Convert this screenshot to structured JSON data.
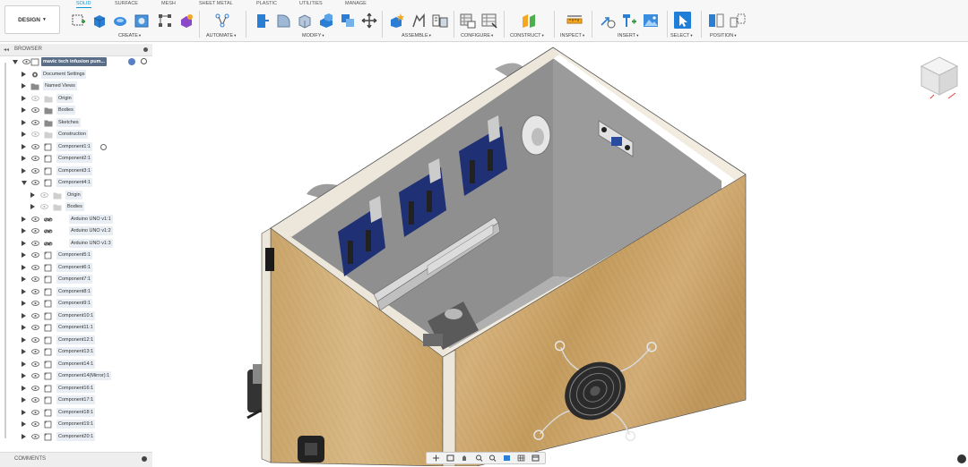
{
  "toolbar": {
    "workspace": "DESIGN",
    "tabs": [
      "SOLID",
      "SURFACE",
      "MESH",
      "SHEET METAL",
      "PLASTIC",
      "UTILITIES",
      "MANAGE"
    ],
    "active_tab": "SOLID",
    "groups": {
      "create": "CREATE",
      "automate": "AUTOMATE",
      "modify": "MODIFY",
      "assemble": "ASSEMBLE",
      "configure": "CONFIGURE",
      "construct": "CONSTRUCT",
      "inspect": "INSPECT",
      "insert": "INSERT",
      "select": "SELECT",
      "position": "POSITION"
    },
    "accent": "#0696d7"
  },
  "browser": {
    "title": "BROWSER",
    "items": [
      {
        "label": "mavic tech infusion pum...",
        "type": "root"
      },
      {
        "label": "Document Settings",
        "type": "settings"
      },
      {
        "label": "Named Views",
        "type": "folder"
      },
      {
        "label": "Origin",
        "type": "folder"
      },
      {
        "label": "Bodies",
        "type": "folder"
      },
      {
        "label": "Sketches",
        "type": "folder"
      },
      {
        "label": "Construction",
        "type": "folder"
      },
      {
        "label": "Component1:1",
        "type": "component"
      },
      {
        "label": "Component2:1",
        "type": "component"
      },
      {
        "label": "Component3:1",
        "type": "component"
      },
      {
        "label": "Component4:1",
        "type": "component"
      },
      {
        "label": "Origin",
        "type": "folder"
      },
      {
        "label": "Bodies",
        "type": "folder"
      },
      {
        "label": "Arduino UNO v1:1",
        "type": "link"
      },
      {
        "label": "Arduino UNO v1:2",
        "type": "link"
      },
      {
        "label": "Arduino UNO v1:3",
        "type": "link"
      },
      {
        "label": "Component5:1",
        "type": "component"
      },
      {
        "label": "Component6:1",
        "type": "component"
      },
      {
        "label": "Component7:1",
        "type": "component"
      },
      {
        "label": "Component8:1",
        "type": "component"
      },
      {
        "label": "Component9:1",
        "type": "component"
      },
      {
        "label": "Component10:1",
        "type": "component"
      },
      {
        "label": "Component11:1",
        "type": "component"
      },
      {
        "label": "Component12:1",
        "type": "component"
      },
      {
        "label": "Component13:1",
        "type": "component"
      },
      {
        "label": "Component14:1",
        "type": "component"
      },
      {
        "label": "Component14(Mirror):1",
        "type": "component"
      },
      {
        "label": "Component16:1",
        "type": "component"
      },
      {
        "label": "Component17:1",
        "type": "component"
      },
      {
        "label": "Component18:1",
        "type": "component"
      },
      {
        "label": "Component19:1",
        "type": "component"
      },
      {
        "label": "Component20:1",
        "type": "component"
      }
    ]
  },
  "comments": {
    "title": "COMMENTS"
  },
  "colors": {
    "wood": "#c8a468",
    "panel_grey": "#8c8c8c",
    "rim": "#ece7da",
    "pcb": "#1e2f6e"
  }
}
